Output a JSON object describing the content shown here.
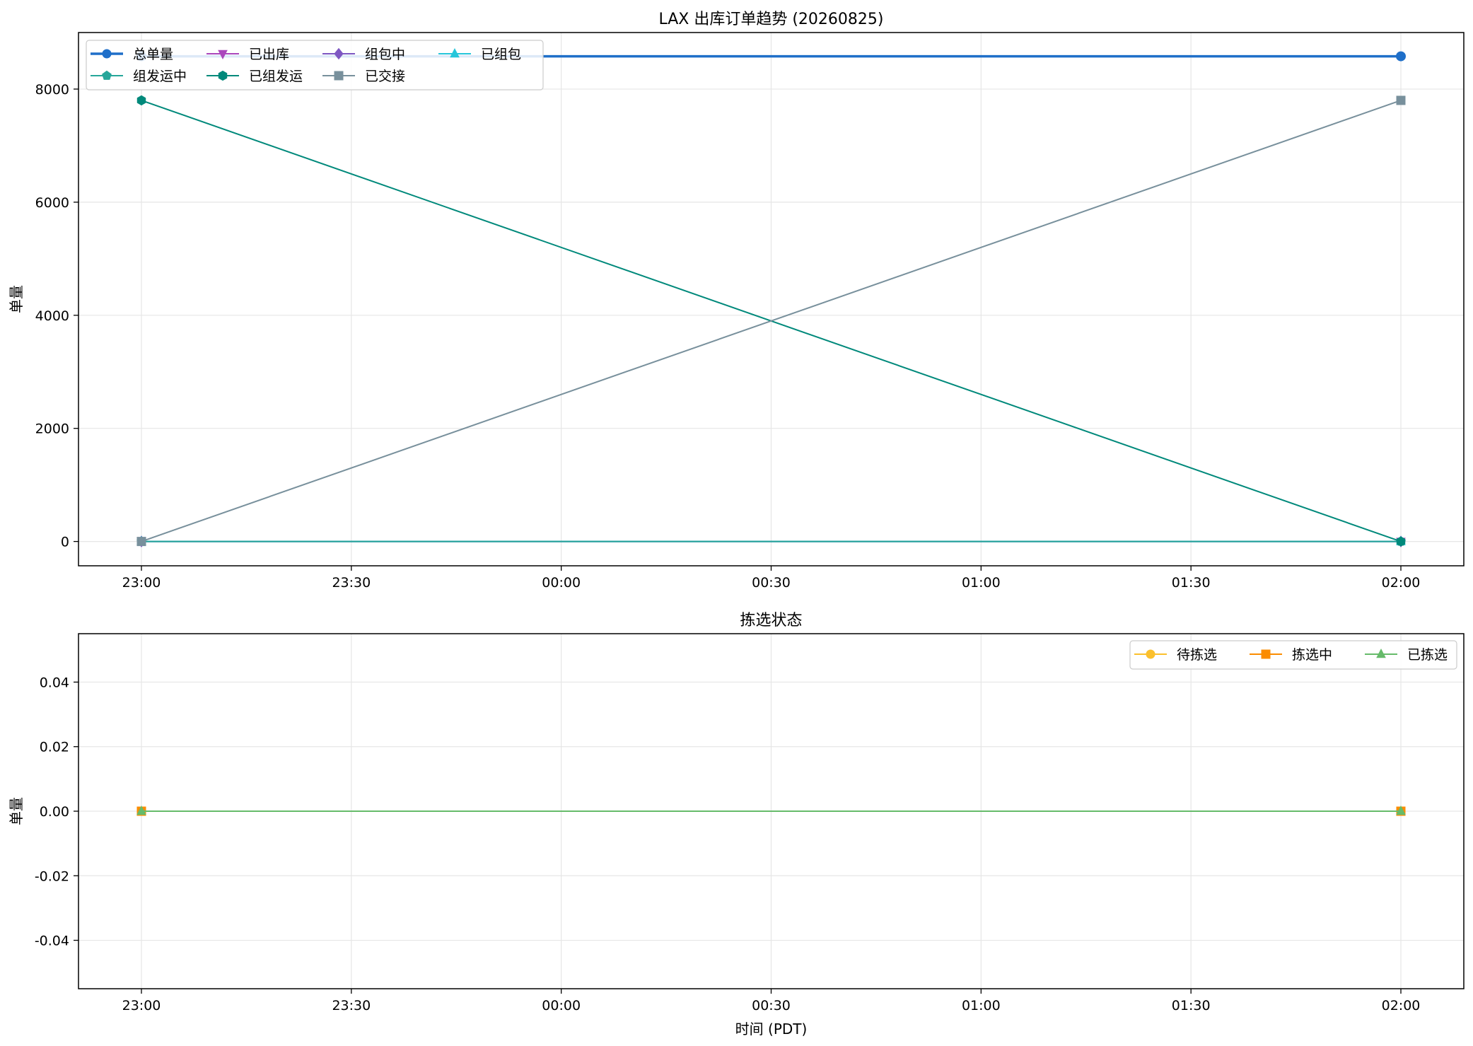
{
  "chart_data": [
    {
      "type": "line",
      "title": "LAX 出库订单趋势 (20260825)",
      "xlabel": "",
      "ylabel": "单量",
      "x": [
        "23:00",
        "02:00"
      ],
      "x_ticks": [
        "23:00",
        "23:30",
        "00:00",
        "00:30",
        "01:00",
        "01:30",
        "02:00"
      ],
      "y_ticks": [
        "0",
        "2000",
        "4000",
        "6000",
        "8000"
      ],
      "ylim": [
        -430,
        9000
      ],
      "grid": true,
      "legend_position": "top-left",
      "legend_columns": 4,
      "series": [
        {
          "name": "总单量",
          "values": [
            8580,
            8580
          ],
          "color": "#1f6fc9",
          "marker": "circle",
          "width": 3.5
        },
        {
          "name": "已出库",
          "values": [
            0,
            0
          ],
          "color": "#ab47bc",
          "marker": "triangle-down",
          "width": 2
        },
        {
          "name": "组包中",
          "values": [
            0,
            0
          ],
          "color": "#7e57c2",
          "marker": "diamond",
          "width": 2
        },
        {
          "name": "已组包",
          "values": [
            0,
            0
          ],
          "color": "#26c6da",
          "marker": "triangle-up",
          "width": 2
        },
        {
          "name": "组发运中",
          "values": [
            0,
            0
          ],
          "color": "#26a69a",
          "marker": "pentagon",
          "width": 2
        },
        {
          "name": "已组发运",
          "values": [
            7800,
            0
          ],
          "color": "#00897b",
          "marker": "hexagon",
          "width": 2
        },
        {
          "name": "已交接",
          "values": [
            0,
            7800
          ],
          "color": "#78909c",
          "marker": "square",
          "width": 2
        }
      ]
    },
    {
      "type": "line",
      "title": "拣选状态",
      "xlabel": "时间 (PDT)",
      "ylabel": "单量",
      "x": [
        "23:00",
        "02:00"
      ],
      "x_ticks": [
        "23:00",
        "23:30",
        "00:00",
        "00:30",
        "01:00",
        "01:30",
        "02:00"
      ],
      "y_ticks": [
        "-0.04",
        "-0.02",
        "0.00",
        "0.02",
        "0.04"
      ],
      "ylim": [
        -0.055,
        0.055
      ],
      "grid": true,
      "legend_position": "top-right",
      "legend_columns": 3,
      "series": [
        {
          "name": "待拣选",
          "values": [
            0,
            0
          ],
          "color": "#fbc02d",
          "marker": "circle",
          "width": 2
        },
        {
          "name": "拣选中",
          "values": [
            0,
            0
          ],
          "color": "#fb8c00",
          "marker": "square",
          "width": 2
        },
        {
          "name": "已拣选",
          "values": [
            0,
            0
          ],
          "color": "#66bb6a",
          "marker": "triangle-up",
          "width": 2
        }
      ]
    }
  ]
}
